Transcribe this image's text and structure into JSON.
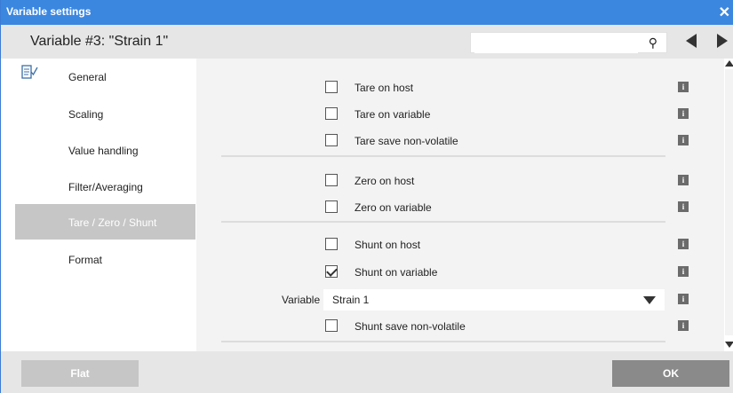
{
  "window": {
    "title": "Variable settings",
    "close_icon": "✕"
  },
  "header": {
    "variable_title": "Variable #3: \"Strain 1\"",
    "search_value": "",
    "search_icon": "⚲"
  },
  "sidebar": {
    "items": [
      {
        "label": "General",
        "icon": "document-check-icon"
      },
      {
        "label": "Scaling"
      },
      {
        "label": "Value handling"
      },
      {
        "label": "Filter/Averaging"
      },
      {
        "label": "Tare / Zero / Shunt",
        "active": true
      },
      {
        "label": "Format"
      }
    ]
  },
  "content": {
    "tare_on_host": {
      "label": "Tare on host",
      "checked": false
    },
    "tare_on_variable": {
      "label": "Tare on variable",
      "checked": false
    },
    "tare_save": {
      "label": "Tare save non-volatile",
      "checked": false
    },
    "zero_on_host": {
      "label": "Zero on host",
      "checked": false
    },
    "zero_on_variable": {
      "label": "Zero on variable",
      "checked": false
    },
    "shunt_on_host": {
      "label": "Shunt on host",
      "checked": false
    },
    "shunt_on_variable": {
      "label": "Shunt on variable",
      "checked": true
    },
    "variable_select": {
      "label": "Variable",
      "value": "Strain 1"
    },
    "shunt_save": {
      "label": "Shunt save non-volatile",
      "checked": false
    },
    "info_glyph": "i"
  },
  "footer": {
    "flat_label": "Flat",
    "ok_label": "OK"
  },
  "colors": {
    "titlebar": "#3b87e0",
    "active_item": "#c6c6c6",
    "ok_button": "#8a8a8a",
    "flat_button": "#c6c6c6"
  }
}
